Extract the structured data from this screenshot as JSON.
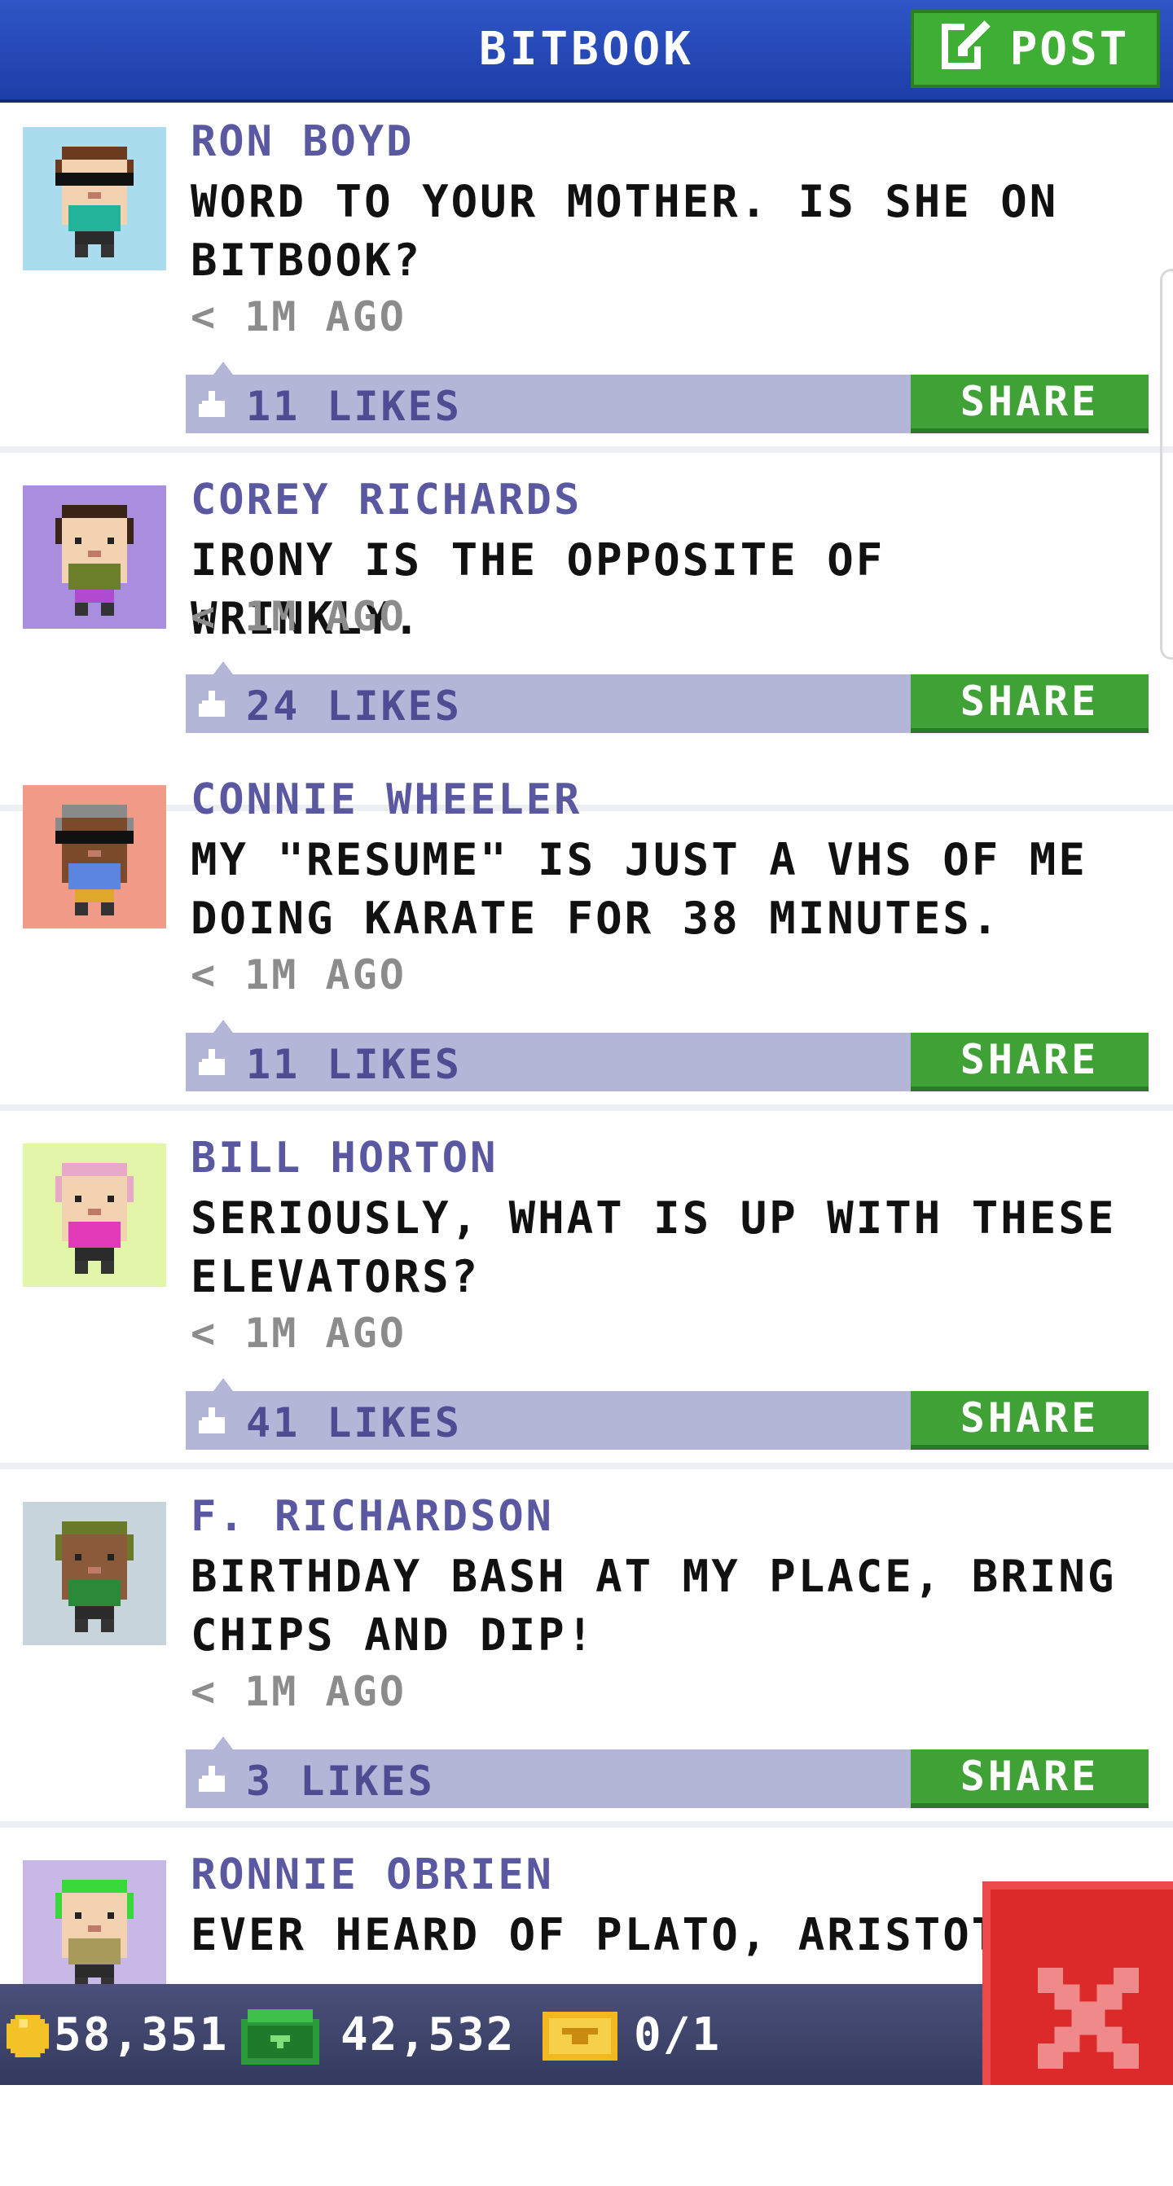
{
  "header": {
    "title": "BITBOOK",
    "post_label": "POST"
  },
  "posts": [
    {
      "name": "RON BOYD",
      "message": "WORD TO YOUR MOTHER. IS SHE ON BITBOOK?",
      "time": "< 1M AGO",
      "likes": "11 LIKES",
      "share": "SHARE"
    },
    {
      "name": "COREY RICHARDS",
      "message": "IRONY IS THE OPPOSITE OF WRINKLY.",
      "time": "< 1M AGO",
      "likes": "24 LIKES",
      "share": "SHARE"
    },
    {
      "name": "CONNIE WHEELER",
      "message": "MY \"RESUME\" IS JUST A VHS OF ME DOING KARATE FOR 38 MINUTES.",
      "time": "< 1M AGO",
      "likes": "11 LIKES",
      "share": "SHARE"
    },
    {
      "name": "BILL HORTON",
      "message": "SERIOUSLY, WHAT IS UP WITH THESE ELEVATORS?",
      "time": "< 1M AGO",
      "likes": "41 LIKES",
      "share": "SHARE"
    },
    {
      "name": "F. RICHARDSON",
      "message": "BIRTHDAY BASH AT MY PLACE, BRING CHIPS AND DIP!",
      "time": "< 1M AGO",
      "likes": "3 LIKES",
      "share": "SHARE"
    },
    {
      "name": "RONNIE OBRIEN",
      "message": "EVER HEARD OF PLATO, ARISTOTLE"
    }
  ],
  "avatars": [
    {
      "bg": "#a9dcec",
      "skin": "#f2d2b0",
      "hair": "#6b3a1f",
      "shirt": "#22b39a",
      "pants": "#2b2b2b",
      "shades": true
    },
    {
      "bg": "#a98ee0",
      "skin": "#f2d2b0",
      "hair": "#3a2418",
      "shirt": "#6b7f2a",
      "pants": "#b04ad0",
      "shades": false
    },
    {
      "bg": "#f29a88",
      "skin": "#7a4a2a",
      "hair": "#8a8a8a",
      "shirt": "#5a86e0",
      "pants": "#e0a82a",
      "shades": true
    },
    {
      "bg": "#e2f5a8",
      "skin": "#f2d2b0",
      "hair": "#e8a8c8",
      "shirt": "#e03ab8",
      "pants": "#2b2b2b",
      "shades": false
    },
    {
      "bg": "#c8d4dc",
      "skin": "#8a5a3a",
      "hair": "#6b7a2a",
      "shirt": "#2a8a3a",
      "pants": "#2b2b2b",
      "shades": false
    },
    {
      "bg": "#c8b8e8",
      "skin": "#f2d2b0",
      "hair": "#3ad83a",
      "shirt": "#a89a5a",
      "pants": "#2b2b2b",
      "shades": false
    }
  ],
  "footer": {
    "coins": "58,351",
    "bux": "42,532",
    "tickets": "0/1"
  },
  "colors": {
    "header": "#2447b8",
    "name": "#5a58a0",
    "like_bar": "#b4b6d8",
    "share": "#3fa136",
    "close": "#dc2929"
  }
}
